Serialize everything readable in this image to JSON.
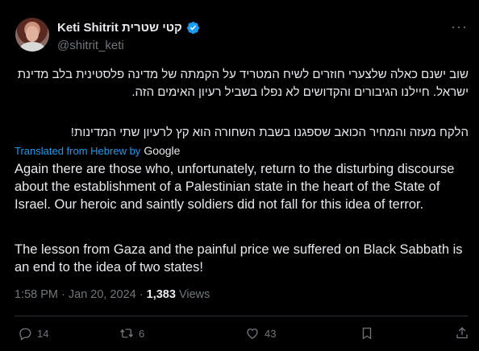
{
  "author": {
    "display_name": "Keti Shitrit קטי שטרית",
    "handle": "@shitrit_keti"
  },
  "hebrew": {
    "paragraph1": "שוב ישנם כאלה שלצערי חוזרים לשיח המטריד על הקמתה של מדינה פלסטינית בלב מדינת ישראל. חיילנו הגיבורים והקדושים לא נפלו בשביל רעיון האימים הזה.",
    "paragraph2": "הלקח מעזה והמחיר הכואב שספגנו בשבת השחורה הוא קץ לרעיון שתי המדינות!"
  },
  "translation": {
    "label": "Translated from Hebrew by",
    "provider": "Google",
    "paragraph1": "Again there are those who, unfortunately, return to the disturbing discourse about the establishment of a Palestinian state in the heart of the State of Israel. Our heroic and saintly soldiers did not fall for this idea of terror.",
    "paragraph2": "The lesson from Gaza and the painful price we suffered on Black Sabbath is an end to the idea of two states!"
  },
  "meta": {
    "timestamp": "1:58 PM · Jan 20, 2024 · ",
    "views_count": "1,383",
    "views_label": " Views"
  },
  "actions": {
    "replies": "14",
    "retweets": "6",
    "likes": "43"
  },
  "colors": {
    "background": "#000000",
    "text": "#e7e9ea",
    "muted": "#71767b",
    "accent": "#1d9bf0"
  },
  "icons": [
    "verified-badge-icon",
    "more-options-icon",
    "reply-icon",
    "retweet-icon",
    "like-icon",
    "bookmark-icon",
    "share-icon"
  ]
}
